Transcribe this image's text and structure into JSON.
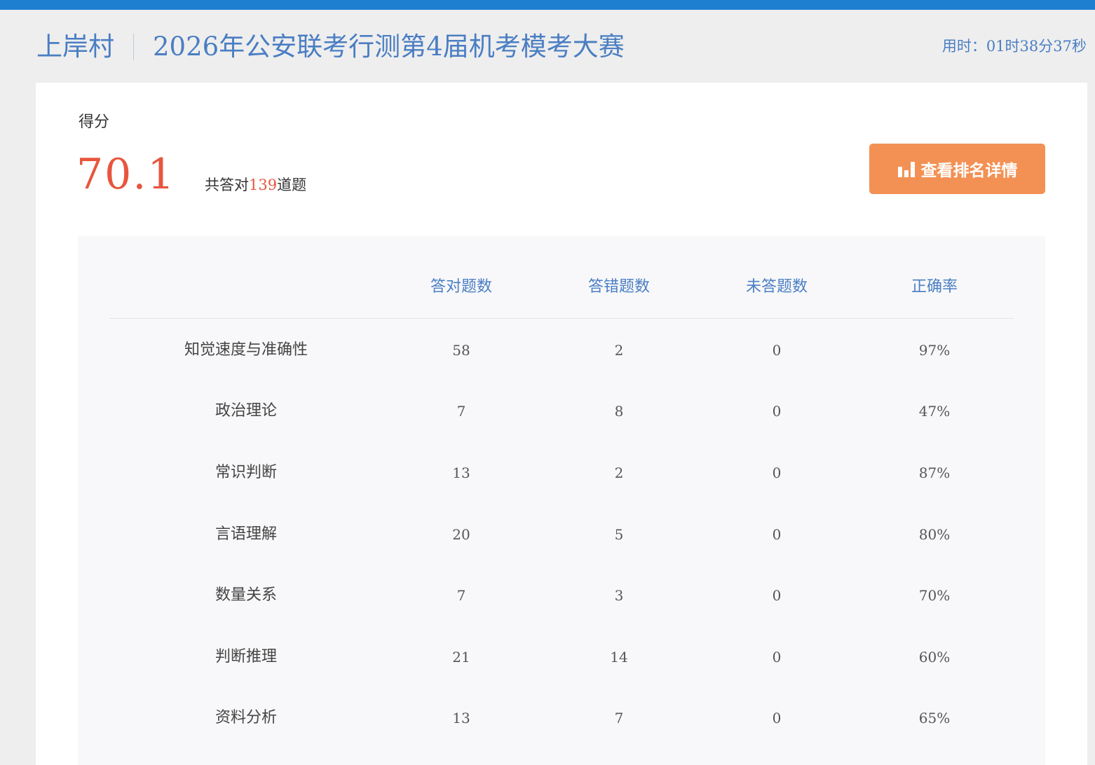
{
  "header": {
    "brand": "上岸村",
    "exam_title": "2026年公安联考行测第4届机考模考大赛",
    "timer": "用时：01时38分37秒"
  },
  "score": {
    "label": "得分",
    "value": "70.1",
    "summary_prefix": "共答对",
    "correct_count": "139",
    "summary_suffix": "道题",
    "rank_button_label": "查看排名详情",
    "rank_button_icon": "bar-chart-icon"
  },
  "colors": {
    "header_bar": "#1e7fd0",
    "accent_blue": "#4a7ec3",
    "score_red": "#e8553e",
    "button_orange": "#f39154"
  },
  "table": {
    "columns": [
      "",
      "答对题数",
      "答错题数",
      "未答题数",
      "正确率"
    ],
    "rows": [
      {
        "name": "知觉速度与准确性",
        "correct": "58",
        "wrong": "2",
        "unanswered": "0",
        "accuracy": "97%"
      },
      {
        "name": "政治理论",
        "correct": "7",
        "wrong": "8",
        "unanswered": "0",
        "accuracy": "47%"
      },
      {
        "name": "常识判断",
        "correct": "13",
        "wrong": "2",
        "unanswered": "0",
        "accuracy": "87%"
      },
      {
        "name": "言语理解",
        "correct": "20",
        "wrong": "5",
        "unanswered": "0",
        "accuracy": "80%"
      },
      {
        "name": "数量关系",
        "correct": "7",
        "wrong": "3",
        "unanswered": "0",
        "accuracy": "70%"
      },
      {
        "name": "判断推理",
        "correct": "21",
        "wrong": "14",
        "unanswered": "0",
        "accuracy": "60%"
      },
      {
        "name": "资料分析",
        "correct": "13",
        "wrong": "7",
        "unanswered": "0",
        "accuracy": "65%"
      }
    ]
  }
}
